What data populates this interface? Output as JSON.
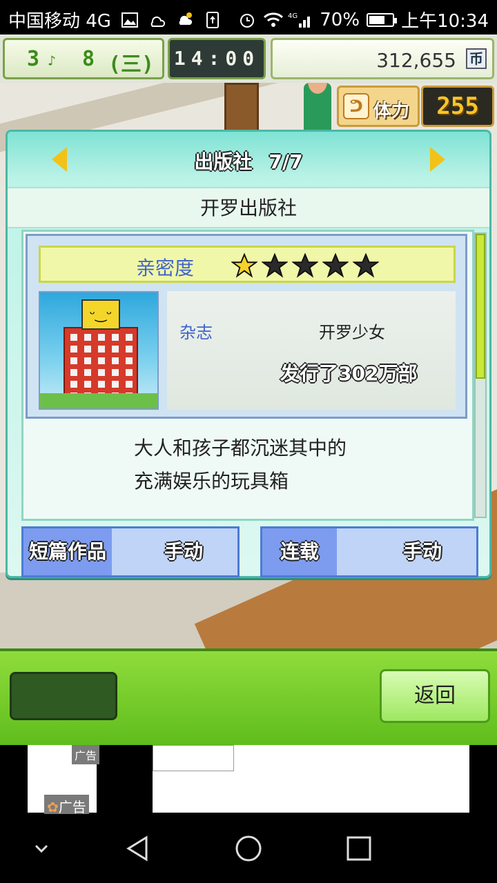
{
  "statusbar": {
    "carrier": "中国移动 4G",
    "network_tag": "4G",
    "battery": "70%",
    "battery_level": 0.7,
    "time": "上午10:34"
  },
  "hud": {
    "month": "3",
    "week": "8",
    "weekday": "(三)",
    "clock": "14:00",
    "money": "312,655",
    "currency": "币",
    "stamina_label": "体力",
    "stamina_value": "255"
  },
  "dialog": {
    "title": "出版社",
    "page": "7/7",
    "publisher_name": "开罗出版社",
    "intimacy_label": "亲密度",
    "intimacy_stars": 1,
    "intimacy_max": 5,
    "work_type": "杂志",
    "work_title": "开罗少女",
    "sales": "发行了302万部",
    "description_line1": "大人和孩子都沉迷其中的",
    "description_line2": "充满娱乐的玩具箱",
    "short_label": "短篇作品",
    "short_value": "手动",
    "serial_label": "连载",
    "serial_value": "手动"
  },
  "bottom": {
    "back_label": "返回"
  },
  "ad": {
    "tag": "广告",
    "tag2": "广告"
  },
  "colors": {
    "dialog_bg": "#bdf3e7",
    "accent_green": "#8fdc3c",
    "arrow_yellow": "#f2c218",
    "label_blue": "#3f64c9"
  },
  "icons": {
    "stamina": "muscle-icon",
    "star_filled": "star-filled-icon",
    "star_empty": "star-empty-icon"
  }
}
